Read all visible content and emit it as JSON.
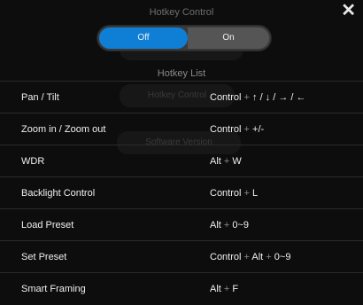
{
  "dialog": {
    "title": "Hotkey Control",
    "close": "✕"
  },
  "toggle": {
    "off_label": "Off",
    "on_label": "On",
    "selected": "Off"
  },
  "list_title": "Hotkey List",
  "ghost": {
    "control": "Hotkey Control",
    "version": "Software Version"
  },
  "hotkeys": [
    {
      "name": "Pan / Tilt",
      "keys": [
        "Control",
        "↑ / ↓ / → / ←"
      ]
    },
    {
      "name": "Zoom in / Zoom out",
      "keys": [
        "Control",
        "+/-"
      ]
    },
    {
      "name": "WDR",
      "keys": [
        "Alt",
        "W"
      ]
    },
    {
      "name": "Backlight Control",
      "keys": [
        "Control",
        "L"
      ]
    },
    {
      "name": "Load Preset",
      "keys": [
        "Alt",
        "0~9"
      ]
    },
    {
      "name": "Set Preset",
      "keys": [
        "Control",
        "Alt",
        "0~9"
      ]
    },
    {
      "name": "Smart Framing",
      "keys": [
        "Alt",
        "F"
      ]
    }
  ]
}
